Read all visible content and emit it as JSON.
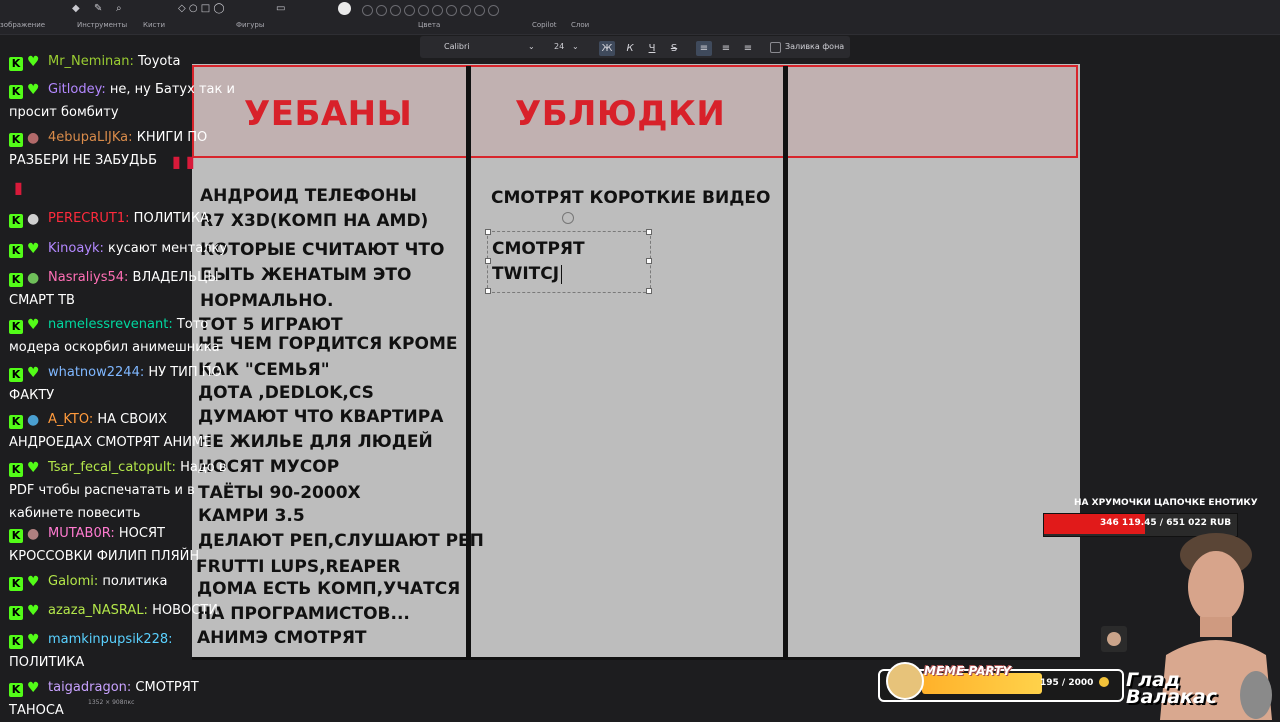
{
  "toolbar": {
    "sections": [
      "зображение",
      "Инструменты",
      "Кисти",
      "Фигуры",
      "Цвета",
      "Copilot",
      "Слои"
    ],
    "text_format": {
      "font": "Calibri",
      "size": "24",
      "bold": "Ж",
      "italic": "К",
      "underline": "Ч",
      "strike": "S",
      "fill_label": "Заливка фона"
    }
  },
  "canvas": {
    "col1_header": "УЕБАНЫ",
    "col2_header": "УБЛЮДКИ",
    "col1_lines": [
      "АНДРОИД ТЕЛЕФОНЫ",
      "R7 X3D(КОМП НА AMD)",
      "КОТОРЫЕ СЧИТАЮТ ЧТО",
      "БЫТЬ ЖЕНАТЫМ ЭТО",
      "НОРМАЛЬНО.",
      "ТОТ 5 ИГРАЮТ",
      "НЕ ЧЕМ ГОРДИТСЯ КРОМЕ",
      "КАК \"СЕМЬЯ\"",
      "ДОТА ,DEDLOK,CS",
      "ДУМАЮТ ЧТО КВАРТИРА",
      "НЕ ЖИЛЬЕ ДЛЯ ЛЮДЕЙ",
      "НОСЯТ МУСОР",
      "ТАЁТЫ 90-2000Х",
      "КАМРИ 3.5",
      "ДЕЛАЮТ РЕП,СЛУШАЮТ РЕП",
      "FRUTTI LUPS,REAPER",
      "ДОМА ЕСТЬ КОМП,УЧАТСЯ",
      "НА ПРОГРАМИСТОВ...",
      "АНИМЭ СМОТРЯТ"
    ],
    "col2_line1": "СМОТРЯТ КОРОТКИЕ ВИДЕО",
    "col2_edit": [
      "СМОТРЯТ",
      "TWITCJ"
    ]
  },
  "chat": [
    {
      "nick": "Mr_Neminan:",
      "color": "#9acd32",
      "msg": "Toyota"
    },
    {
      "nick": "Gitlodey:",
      "color": "#b388ff",
      "msg": "не, ну Батух так и просит бомбиту"
    },
    {
      "nick": "4ebupaLIJKa:",
      "color": "#d98b4a",
      "msg": "КНИГИ ПО РАЗБЕРИ НЕ ЗАБУДЬБ"
    },
    {
      "nick": "PERECRUT1:",
      "color": "#ff2a3c",
      "msg": "ПОЛИТИКА"
    },
    {
      "nick": "Kinoayk:",
      "color": "#b388ff",
      "msg": "кусают менталку"
    },
    {
      "nick": "Nasraliys54:",
      "color": "#ff6fb5",
      "msg": "ВЛАДЕЛЬЦЫ СМАРТ ТВ"
    },
    {
      "nick": "namelessrevenant:",
      "color": "#00d8a0",
      "msg": "Тото модера оскорбил анимешника"
    },
    {
      "nick": "whatnow2244:",
      "color": "#7fb7ff",
      "msg": "НУ ТИП ПО ФАКТУ"
    },
    {
      "nick": "A_KTO:",
      "color": "#ff9a3c",
      "msg": "НА СВОИХ АНДРОЕДАХ СМОТРЯТ АНИМЕ"
    },
    {
      "nick": "Tsar_fecal_catopult:",
      "color": "#b3e64a",
      "msg": "Надо в PDF чтобы распечатать и в кабинете повесить"
    },
    {
      "nick": "MUTAB0R:",
      "color": "#ff7bd0",
      "msg": "НОСЯТ КРОССОВКИ ФИЛИП ПЛЯЙН"
    },
    {
      "nick": "Galomi:",
      "color": "#b3e64a",
      "msg": "политика"
    },
    {
      "nick": "azaza_NASRAL:",
      "color": "#b3e64a",
      "msg": "НОВОСТИ"
    },
    {
      "nick": "mamkinpupsik228:",
      "color": "#5ad1ff",
      "msg": "ПОЛИТИКА"
    },
    {
      "nick": "taigadragon:",
      "color": "#c8a2ff",
      "msg": "СМОТРЯТ ТАНОСА"
    }
  ],
  "status_bar": "1352 × 908пкс",
  "goal": {
    "title": "НА ХРУМОЧКИ ЦАПОЧКЕ ЕНОТИКУ",
    "amount": "346 119.45 / 651 022 RUB",
    "progress": 0.53
  },
  "meme_party": {
    "label": "MEME PARTY",
    "count": "195 / 2000"
  },
  "streamer_name": "Глад Валакас"
}
